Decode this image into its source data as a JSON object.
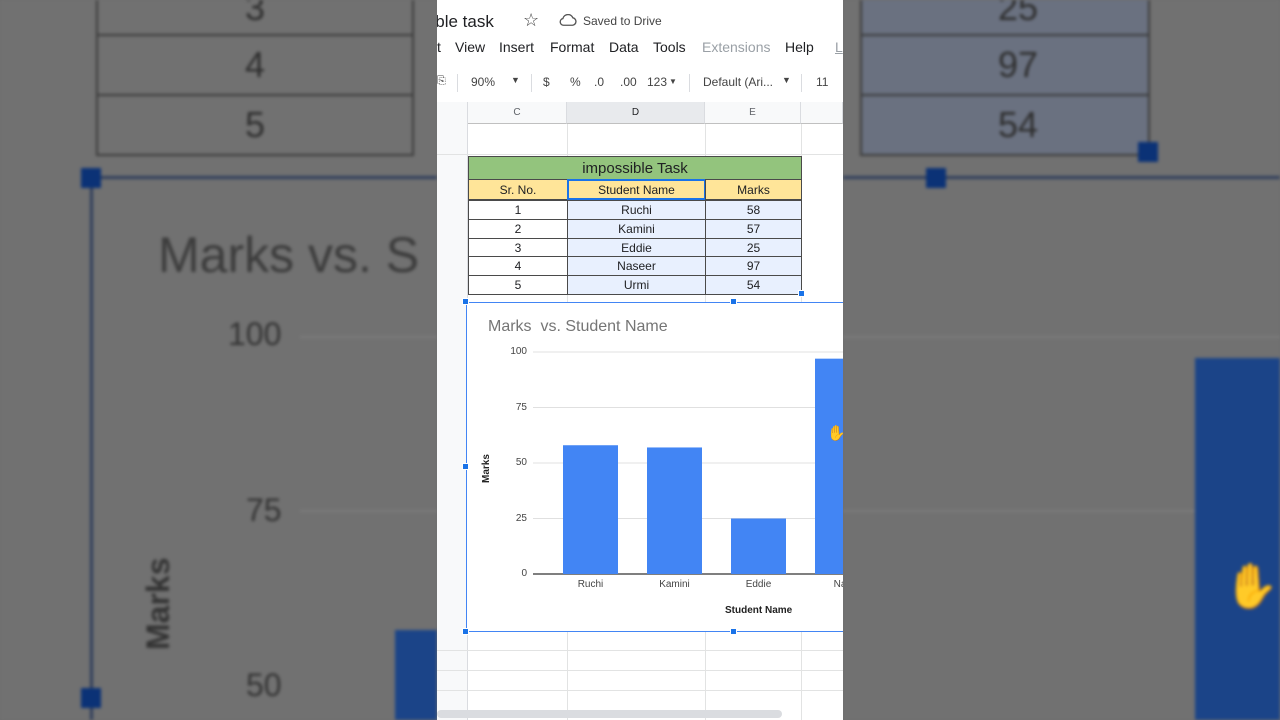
{
  "doc": {
    "title": "sible task",
    "saved_status": "Saved to Drive"
  },
  "menu": [
    "t",
    "View",
    "Insert",
    "Format",
    "Data",
    "Tools",
    "Extensions",
    "Help",
    "L"
  ],
  "toolbar": {
    "zoom": "90%",
    "currency": "$",
    "percent": "%",
    "dec_decrease": ".0",
    "dec_increase": ".00",
    "more_formats": "123",
    "font": "Default (Ari...",
    "font_size": "11"
  },
  "columns": [
    "C",
    "D",
    "E"
  ],
  "table": {
    "title": "impossible Task",
    "headers": [
      "Sr. No.",
      "Student Name",
      "Marks"
    ],
    "rows": [
      [
        "1",
        "Ruchi",
        "58"
      ],
      [
        "2",
        "Kamini",
        "57"
      ],
      [
        "3",
        "Eddie",
        "25"
      ],
      [
        "4",
        "Naseer",
        "97"
      ],
      [
        "5",
        "Urmi",
        "54"
      ]
    ]
  },
  "chart_data": {
    "type": "bar",
    "title": "Marks  vs. Student Name",
    "xlabel": "Student Name",
    "ylabel": "Marks",
    "categories": [
      "Ruchi",
      "Kamini",
      "Eddie",
      "Nas"
    ],
    "values": [
      58,
      57,
      25,
      97
    ],
    "ylim": [
      0,
      100
    ],
    "yticks": [
      "100",
      "75",
      "50",
      "25",
      "0"
    ],
    "grid": true,
    "bar_color": "#4285f4"
  },
  "background": {
    "row_numbers": [
      "3",
      "4",
      "5"
    ],
    "marks": [
      "25",
      "97",
      "54"
    ],
    "chart_title": "Marks  vs. S",
    "yticks": [
      "100",
      "75",
      "50"
    ],
    "ylabel": "Marks"
  }
}
